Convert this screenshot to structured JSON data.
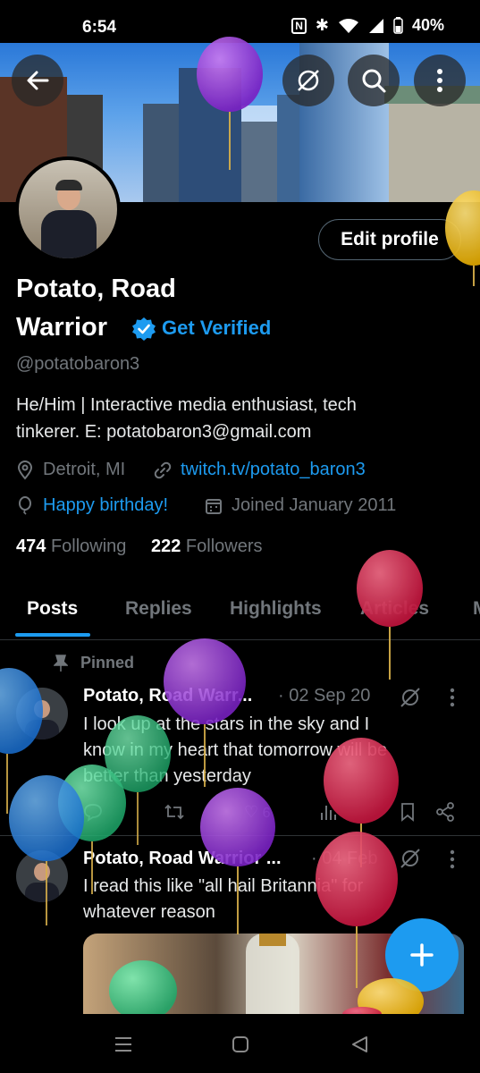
{
  "status_bar": {
    "time": "6:54",
    "battery": "40%"
  },
  "header": {
    "back_label": "Back",
    "edit_profile_label": "Edit profile"
  },
  "profile": {
    "name_line1": "Potato, Road",
    "name_line2": "Warrior",
    "get_verified": "Get Verified",
    "handle": "@potatobaron3",
    "bio_line1": "He/Him | Interactive media enthusiast, tech",
    "bio_line2": "tinkerer.  E: potatobaron3@gmail.com",
    "location": "Detroit, MI",
    "website": "twitch.tv/potato_baron3",
    "birthday": "Happy birthday!",
    "joined": "Joined January 2011",
    "following_count": "474",
    "following_label": "Following",
    "followers_count": "222",
    "followers_label": "Followers"
  },
  "tabs": [
    {
      "label": "Posts"
    },
    {
      "label": "Replies"
    },
    {
      "label": "Highlights"
    },
    {
      "label": "Articles"
    },
    {
      "label": "M"
    }
  ],
  "posts": [
    {
      "pinned_label": "Pinned",
      "author": "Potato, Road Warr...",
      "date": "· 02 Sep 20",
      "text_line1": "I look up at the stars in the sky and I",
      "text_line2": "know in my heart that tomorrow will be",
      "text_line3": "better than yesterday",
      "likes": "6"
    },
    {
      "author": "Potato, Road Warrior ...",
      "date": "· 04 Feb",
      "text_line1": "I read this like \"all hail Britannia\" for",
      "text_line2": "whatever reason"
    }
  ],
  "colors": {
    "accent": "#1d9bf0",
    "background": "#000000",
    "muted": "#71767b"
  },
  "icons": [
    "back-arrow-icon",
    "grok-icon",
    "search-icon",
    "more-vertical-icon",
    "verified-badge-icon",
    "location-icon",
    "link-icon",
    "balloon-icon",
    "calendar-icon",
    "pin-icon",
    "reply-icon",
    "repost-icon",
    "like-icon",
    "views-icon",
    "bookmark-icon",
    "share-icon",
    "compose-plus-icon"
  ]
}
